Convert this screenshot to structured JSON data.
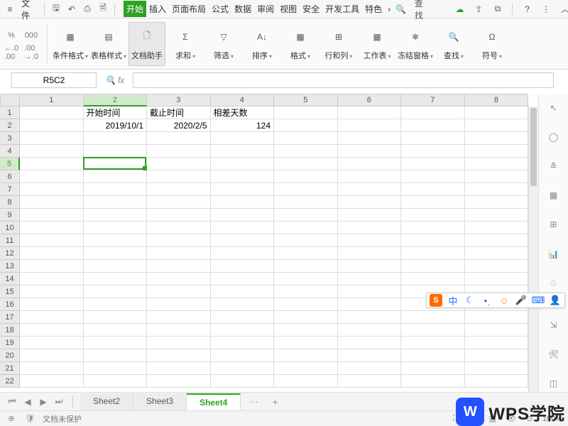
{
  "menubar": {
    "file_label": "文件",
    "tabs": [
      "开始",
      "插入",
      "页面布局",
      "公式",
      "数据",
      "审阅",
      "视图",
      "安全",
      "开发工具",
      "特色"
    ],
    "active_tab": 0,
    "search_label": "查找"
  },
  "ribbon": {
    "small": {
      "percent": "%",
      "comma": "000",
      "dec_inc": ".0",
      "dec_dec": ".00"
    },
    "buttons": [
      {
        "id": "cond-format",
        "label": "条件格式",
        "drop": true
      },
      {
        "id": "table-style",
        "label": "表格样式",
        "drop": true
      },
      {
        "id": "doc-assist",
        "label": "文档助手",
        "drop": false,
        "active": true
      },
      {
        "id": "sum",
        "label": "求和",
        "drop": true
      },
      {
        "id": "filter",
        "label": "筛选",
        "drop": true
      },
      {
        "id": "sort",
        "label": "排序",
        "drop": true
      },
      {
        "id": "format",
        "label": "格式",
        "drop": true
      },
      {
        "id": "rowcol",
        "label": "行和列",
        "drop": true
      },
      {
        "id": "worksheet",
        "label": "工作表",
        "drop": true
      },
      {
        "id": "freeze",
        "label": "冻结窗格",
        "drop": true
      },
      {
        "id": "find",
        "label": "查找",
        "drop": true
      },
      {
        "id": "symbol",
        "label": "符号",
        "drop": true
      }
    ]
  },
  "formula": {
    "name_box": "R5C2",
    "fx": "fx",
    "value": ""
  },
  "grid": {
    "cols": [
      "1",
      "2",
      "3",
      "4",
      "5",
      "6",
      "7",
      "8"
    ],
    "rows_count": 22,
    "selected": {
      "row": 5,
      "col": 2
    },
    "cells": {
      "1": {
        "2": "开始时间",
        "3": "截止时间",
        "4": "相差天数"
      },
      "2": {
        "2": "2019/10/1",
        "3": "2020/2/5",
        "4": "124"
      }
    }
  },
  "sheet_tabs": {
    "tabs": [
      "Sheet2",
      "Sheet3",
      "Sheet4"
    ],
    "active": 2
  },
  "statusbar": {
    "protect": "文档未保护",
    "zoom": "100%"
  },
  "ime": {
    "lang": "中"
  },
  "watermark": {
    "text": "WPS学院"
  }
}
